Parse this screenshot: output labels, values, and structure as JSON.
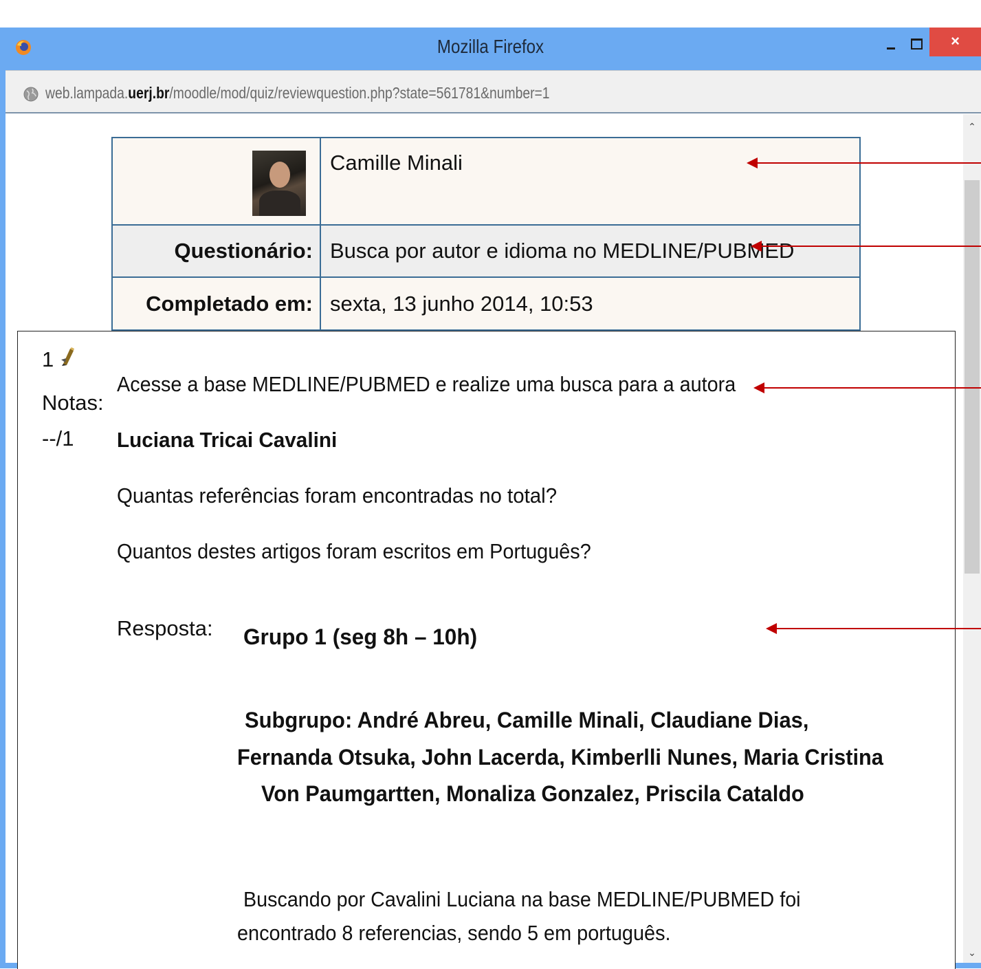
{
  "window": {
    "title": "Mozilla Firefox",
    "close_glyph": "×"
  },
  "address_bar": {
    "url_prefix": "web.lampada.",
    "url_domain": "uerj.br",
    "url_path": "/moodle/mod/quiz/reviewquestion.php?state=561781&number=1"
  },
  "summary": {
    "student_name": "Camille Minali",
    "quiz_label": "Questionário:",
    "quiz_value": "Busca por autor e idioma no MEDLINE/PUBMED",
    "completed_label": "Completado em:",
    "completed_value": "sexta, 13 junho 2014, 10:53"
  },
  "question": {
    "number": "1",
    "notas_label": "Notas:",
    "grade": "--/1",
    "line1": "Acesse a base MEDLINE/PUBMED e realize uma busca para a autora",
    "author": "Luciana Tricai Cavalini",
    "line2": "Quantas referências foram encontradas no total?",
    "line3": "Quantos destes artigos foram escritos em Português?",
    "response_label": "Resposta:"
  },
  "answer": {
    "group": "Grupo 1 (seg 8h – 10h)",
    "subgroup_line1": "Subgrupo: André Abreu, Camille Minali, Claudiane Dias,",
    "subgroup_line2": "Fernanda Otsuka, John Lacerda, Kimberlli Nunes, Maria Cristina",
    "subgroup_line3": "Von Paumgartten, Monaliza Gonzalez, Priscila Cataldo",
    "text_line1": "Buscando por Cavalini Luciana na base MEDLINE/PUBMED foi",
    "text_line2": "encontrado 8 referencias, sendo 5 em português."
  },
  "colors": {
    "title_bar": "#6baaf2",
    "close_button": "#e04b43",
    "table_border": "#3a6c95",
    "annotation_arrow": "#c00000"
  },
  "icons": [
    "firefox-icon",
    "globe-icon",
    "minimize-icon",
    "maximize-icon",
    "close-icon",
    "pencil-icon",
    "scroll-up-icon",
    "scroll-down-icon"
  ]
}
